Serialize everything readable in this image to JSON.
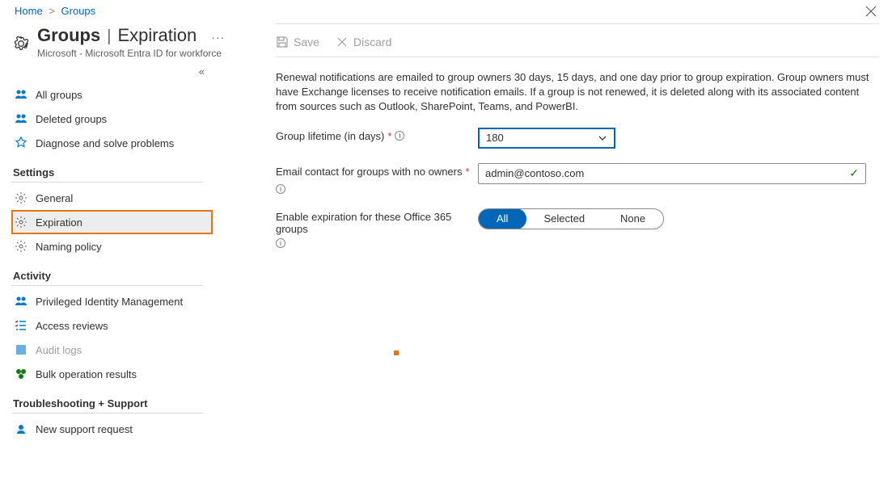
{
  "breadcrumb": {
    "home": "Home",
    "groups": "Groups"
  },
  "header": {
    "title": "Groups",
    "section": "Expiration",
    "subtitle": "Microsoft - Microsoft Entra ID for workforce"
  },
  "toolbar": {
    "save": "Save",
    "discard": "Discard"
  },
  "sidebar": {
    "items": [
      {
        "label": "All groups"
      },
      {
        "label": "Deleted groups"
      },
      {
        "label": "Diagnose and solve problems"
      }
    ],
    "settings_hdr": "Settings",
    "settings": [
      {
        "label": "General"
      },
      {
        "label": "Expiration"
      },
      {
        "label": "Naming policy"
      }
    ],
    "activity_hdr": "Activity",
    "activity": [
      {
        "label": "Privileged Identity Management"
      },
      {
        "label": "Access reviews"
      },
      {
        "label": "Audit logs"
      },
      {
        "label": "Bulk operation results"
      }
    ],
    "support_hdr": "Troubleshooting + Support",
    "support": [
      {
        "label": "New support request"
      }
    ]
  },
  "main": {
    "description": "Renewal notifications are emailed to group owners 30 days, 15 days, and one day prior to group expiration. Group owners must have Exchange licenses to receive notification emails. If a group is not renewed, it is deleted along with its associated content from sources such as Outlook, SharePoint, Teams, and PowerBI.",
    "lifetime_label": "Group lifetime (in days)",
    "lifetime_value": "180",
    "email_label": "Email contact for groups with no owners",
    "email_value": "admin@contoso.com",
    "enable_label": "Enable expiration for these Office 365 groups",
    "pills": {
      "all": "All",
      "selected": "Selected",
      "none": "None"
    }
  }
}
